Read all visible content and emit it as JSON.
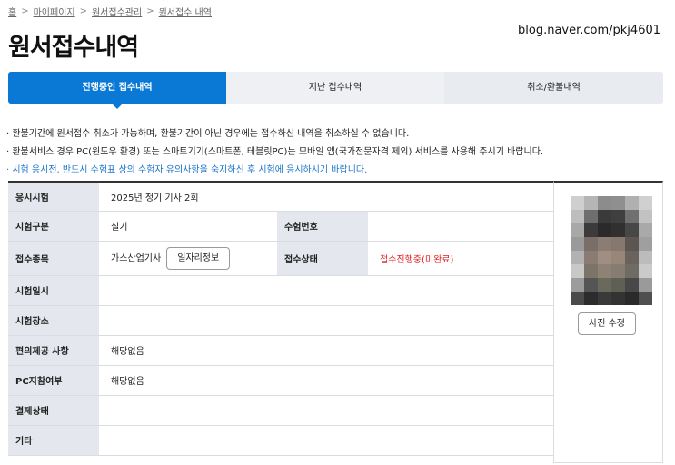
{
  "breadcrumb": {
    "home": "홈",
    "items": [
      "마이페이지",
      "원서접수관리",
      "원서접수 내역"
    ],
    "separator": ">"
  },
  "page_title": "원서접수내역",
  "watermark": "blog.naver.com/pkj4601",
  "tabs": [
    {
      "label": "진행중인 접수내역",
      "active": true
    },
    {
      "label": "지난 접수내역",
      "active": false
    },
    {
      "label": "취소/환불내역",
      "active": false
    }
  ],
  "notices": [
    "· 환불기간에 원서접수 취소가 가능하며, 환불기간이 아닌 경우에는 접수하신 내역을 취소하실 수 없습니다.",
    "· 환불서비스 경우 PC(윈도우 환경) 또는 스마트기기(스마트폰, 테블릿PC)는 모바일 앱(국가전문자격 제외) 서비스를 사용해 주시기 바랍니다.",
    "· 시험 응시전, 반드시 수험표 상의 수험자 유의사항을 숙지하신 후 시험에 응시하시기 바랍니다."
  ],
  "table": {
    "exam_label": "응시시험",
    "exam_value": "2025년 정기 기사 2회",
    "category_label": "시험구분",
    "category_value": "실기",
    "exam_no_label": "수험번호",
    "exam_no_value": "",
    "item_label": "접수종목",
    "item_value": "가스산업기사",
    "job_info_button": "일자리정보",
    "status_label": "접수상태",
    "status_value": "접수진행중(미완료)",
    "date_label": "시험일시",
    "date_value": "",
    "place_label": "시험장소",
    "place_value": "",
    "convenience_label": "편의제공 사항",
    "convenience_value": "해당없음",
    "pc_label": "PC지참여부",
    "pc_value": "해당없음",
    "payment_label": "결제상태",
    "payment_value": "",
    "etc_label": "기타",
    "etc_value": ""
  },
  "photo": {
    "edit_button": "사진 수정"
  },
  "colors": {
    "accent": "#0a79d6",
    "status_red": "#e02020",
    "notice_blue": "#1a74c8"
  }
}
